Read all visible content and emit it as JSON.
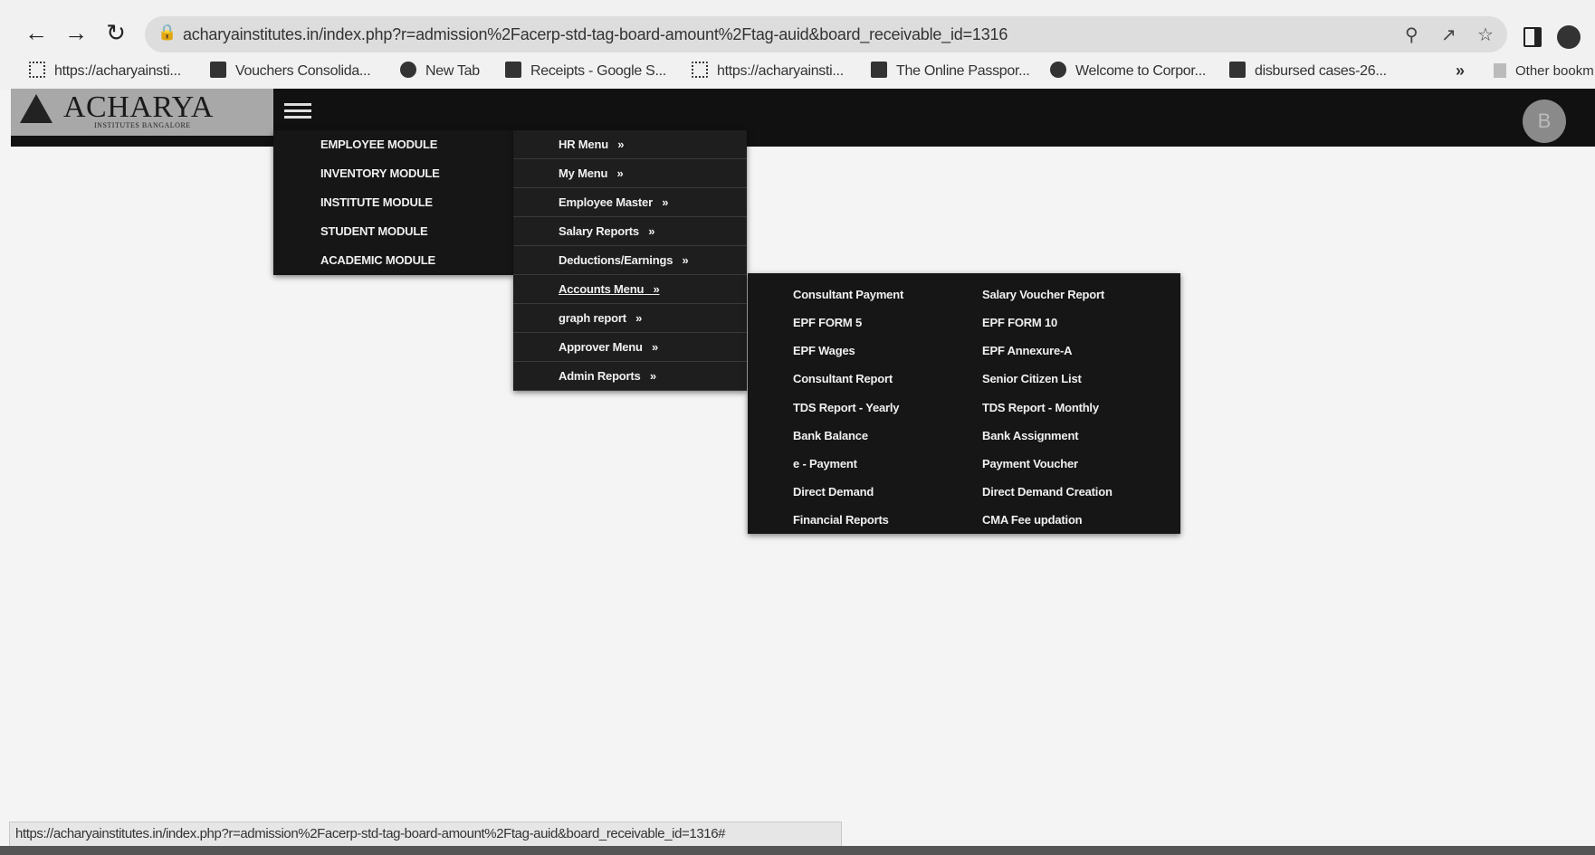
{
  "browser": {
    "url": "acharyainstitutes.in/index.php?r=admission%2Facerp-std-tag-board-amount%2Ftag-auid&board_receivable_id=1316",
    "icons": [
      "back-icon",
      "forward-icon",
      "reload-icon",
      "lock-icon",
      "zoom-icon",
      "share-icon",
      "star-icon",
      "side-panel-icon",
      "profile-icon"
    ],
    "bookmarks": [
      {
        "label": "https://acharyainsti...",
        "icon": "grid-icon"
      },
      {
        "label": "Vouchers Consolida...",
        "icon": "sheet-icon"
      },
      {
        "label": "New Tab",
        "icon": "globe-icon"
      },
      {
        "label": "Receipts - Google S...",
        "icon": "sheet-icon"
      },
      {
        "label": "https://acharyainsti...",
        "icon": "grid-icon"
      },
      {
        "label": "The Online Passpor...",
        "icon": "building-icon"
      },
      {
        "label": "Welcome to Corpor...",
        "icon": "globe-icon"
      },
      {
        "label": "disbursed cases-26...",
        "icon": "sheet-icon"
      }
    ],
    "bookmarks_more": "»",
    "bookmarks_other": "Other bookm",
    "status_url": "https://acharyainstitutes.in/index.php?r=admission%2Facerp-std-tag-board-amount%2Ftag-auid&board_receivable_id=1316#"
  },
  "header": {
    "logo_text": "ACHARYA",
    "logo_subtext": "INSTITUTES BANGALORE",
    "avatar_initial": "B"
  },
  "modules_menu": [
    "EMPLOYEE MODULE",
    "INVENTORY MODULE",
    "INSTITUTE MODULE",
    "STUDENT MODULE",
    "ACADEMIC MODULE"
  ],
  "employee_submenu": {
    "items": [
      "HR Menu",
      "My Menu",
      "Employee Master",
      "Salary Reports",
      "Deductions/Earnings",
      "Accounts Menu",
      "graph report",
      "Approver Menu",
      "Admin Reports"
    ],
    "arrow": "»",
    "active": "Accounts Menu"
  },
  "accounts_menu": {
    "left_column": [
      "Consultant Payment",
      "EPF FORM 5",
      "EPF Wages",
      "Consultant Report",
      "TDS Report - Yearly",
      "Bank Balance",
      "e - Payment",
      "Direct Demand",
      "Financial Reports"
    ],
    "right_column": [
      "Salary Voucher Report",
      "EPF FORM 10",
      "EPF Annexure-A",
      "Senior Citizen List",
      "TDS Report - Monthly",
      "Bank Assignment",
      "Payment Voucher",
      "Direct Demand Creation",
      "CMA Fee updation"
    ]
  }
}
